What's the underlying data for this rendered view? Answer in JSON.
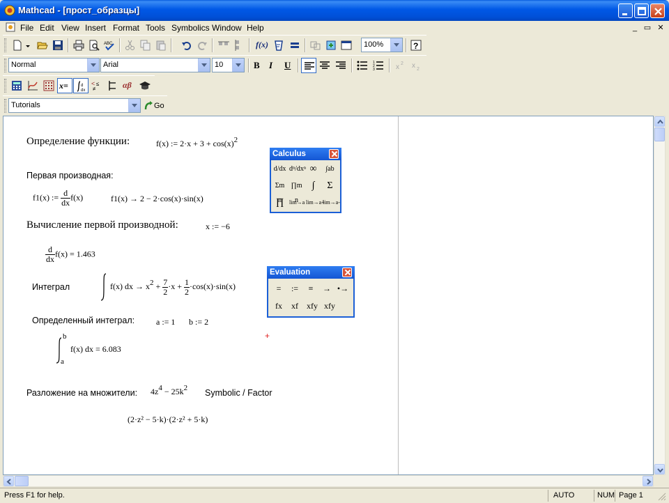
{
  "window": {
    "title": "Mathcad - [прост_образцы]",
    "accent_color": "#0058e6"
  },
  "menu": [
    "File",
    "Edit",
    "View",
    "Insert",
    "Format",
    "Tools",
    "Symbolics",
    "Window",
    "Help"
  ],
  "toolbar": {
    "zoom": "100%",
    "style": "Normal",
    "font": "Arial",
    "font_size": "10",
    "bold_label": "B",
    "italic_label": "I",
    "underline_label": "U",
    "tutorials": "Tutorials",
    "go_label": "Go",
    "fx_label": "f(x)",
    "x_eq_label": "x=",
    "alpha_beta_label": "αβ"
  },
  "worksheet": {
    "def_label": "Определение функции:",
    "def_expr": "f(x) := 2·x + 3 + cos(x)",
    "def_power": "2",
    "first_deriv_label": "Первая производная:",
    "f1_name": "f1(x) :=",
    "d_num": "d",
    "d_den": "dx",
    "f1_tail": "f(x)",
    "f1_symbolic": "f1(x) → 2 − 2·cos(x)·sin(x)",
    "eval_first_label": "Вычисление первой производной:",
    "x_assign": "x := −6",
    "deriv_value": "f(x) = 1.463",
    "integral_label": "Интеграл",
    "integral_expr": "f(x) dx → x",
    "integral_x_power": "2",
    "frac7_num": "7",
    "frac7_den": "2",
    "frac1_num": "1",
    "frac1_den": "2",
    "integral_tail1": "·x +",
    "integral_tail2": "·cos(x)·sin(x)",
    "definite_label": "Определенный интеграл:",
    "a_assign": "a := 1",
    "b_assign": "b := 2",
    "def_int_upper": "b",
    "def_int_lower": "a",
    "def_int_expr": "f(x) dx = 6.083",
    "factor_label": "Разложение на множители:",
    "factor_expr_a": "4z",
    "factor_pow_a": "4",
    "factor_expr_b": " − 25k",
    "factor_pow_b": "2",
    "factor_command": "Symbolic / Factor",
    "factor_result": "(2·z² − 5·k)·(2·z² + 5·k)"
  },
  "palettes": {
    "calculus": {
      "title": "Calculus",
      "buttons": [
        "d/dx",
        "dⁿ/dxⁿ",
        "∞",
        "∫ab",
        "Σm n",
        "∏m n",
        "∫",
        "Σ",
        "∏",
        "lim→a",
        "lim→a+",
        "lim→a-"
      ]
    },
    "evaluation": {
      "title": "Evaluation",
      "buttons": [
        "=",
        ":=",
        "≡",
        "→",
        "•→",
        "fx",
        "xf",
        "xfy",
        "xfy"
      ]
    }
  },
  "statusbar": {
    "help": "Press F1 for help.",
    "mode": "AUTO",
    "num": "NUM",
    "page": "Page 1"
  }
}
